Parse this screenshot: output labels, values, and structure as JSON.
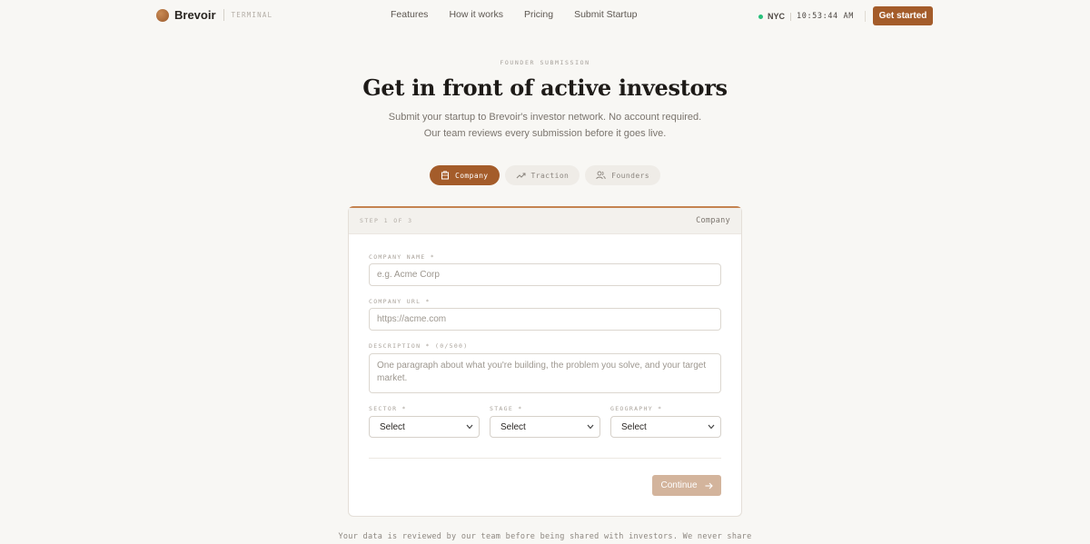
{
  "brand": {
    "name": "Brevoir",
    "tag": "TERMINAL"
  },
  "nav": [
    "Features",
    "How it works",
    "Pricing",
    "Submit Startup"
  ],
  "clock": {
    "city": "NYC",
    "time": "10:53:44 AM"
  },
  "cta": "Get started",
  "hero": {
    "eyebrow": "FOUNDER SUBMISSION",
    "title": "Get in front of active investors",
    "subtitle": "Submit your startup to Brevoir's investor network. No account required. Our team reviews every submission before it goes live."
  },
  "tabs": [
    {
      "label": "Company",
      "icon": "building-icon",
      "active": true
    },
    {
      "label": "Traction",
      "icon": "trend-icon",
      "active": false
    },
    {
      "label": "Founders",
      "icon": "users-icon",
      "active": false
    }
  ],
  "form": {
    "step": "STEP 1 OF 3",
    "step_name": "Company",
    "company_name": {
      "label": "COMPANY NAME *",
      "placeholder": "e.g. Acme Corp"
    },
    "company_url": {
      "label": "COMPANY URL *",
      "placeholder": "https://acme.com"
    },
    "description": {
      "label": "DESCRIPTION * (0/500)",
      "placeholder": "One paragraph about what you're building, the problem you solve, and your target market."
    },
    "sector": {
      "label": "SECTOR *",
      "value": "Select"
    },
    "stage": {
      "label": "STAGE *",
      "value": "Select"
    },
    "geography": {
      "label": "GEOGRAPHY *",
      "value": "Select"
    },
    "continue": "Continue"
  },
  "footer_note": "Your data is reviewed by our team before being shared with investors. We never share"
}
